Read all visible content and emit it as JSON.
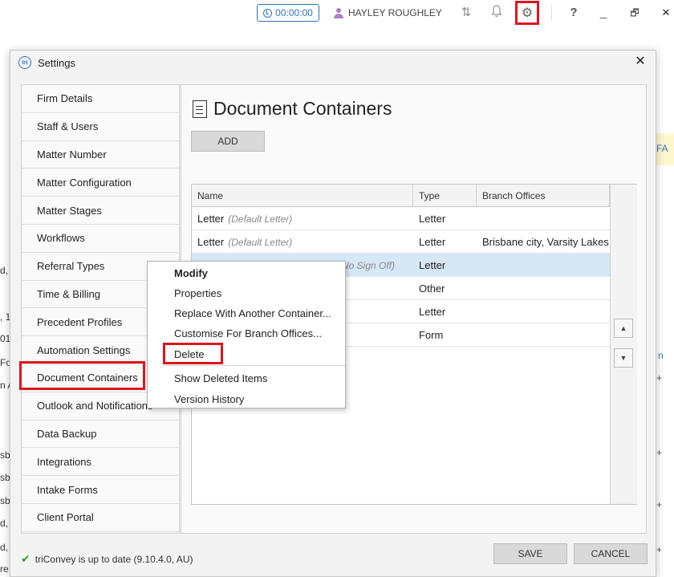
{
  "topbar": {
    "timer": "00:00:00",
    "user_name": "HAYLEY ROUGHLEY",
    "icons": {
      "sync": "sync-arrows-icon",
      "bell": "bell-icon",
      "gear": "gear-icon",
      "help": "?",
      "minimize": "_",
      "restore": "restore-icon",
      "close": "✕"
    }
  },
  "background": {
    "left_fragments": [
      "d,",
      ", 1",
      "01",
      "Fo",
      "n A",
      "sba",
      "sba",
      "sba",
      "d,",
      "d,",
      "re"
    ],
    "right_fragments": [
      "FA",
      "n",
      "+",
      "+",
      "+",
      "+"
    ]
  },
  "dialog": {
    "title": "Settings",
    "nav": [
      "Firm Details",
      "Staff & Users",
      "Matter Number",
      "Matter Configuration",
      "Matter Stages",
      "Workflows",
      "Referral Types",
      "Time & Billing",
      "Precedent Profiles",
      "Automation Settings",
      "Document Containers",
      "Outlook and Notifications",
      "Data Backup",
      "Integrations",
      "Intake Forms",
      "Client Portal"
    ],
    "page_title": "Document Containers",
    "add_label": "ADD",
    "columns": [
      "Name",
      "Type",
      "Branch Offices"
    ],
    "rows": [
      {
        "name": "Letter",
        "note": "(Default Letter)",
        "type": "Letter",
        "branch": ""
      },
      {
        "name": "Letter",
        "note": "(Default Letter)",
        "type": "Letter",
        "branch": "Brisbane city, Varsity Lakes"
      },
      {
        "name": "",
        "note": "No Sign Off)",
        "type": "Letter",
        "branch": ""
      },
      {
        "name": "",
        "note": "",
        "type": "Other",
        "branch": ""
      },
      {
        "name": "",
        "note": "",
        "type": "Letter",
        "branch": ""
      },
      {
        "name": "",
        "note": "",
        "type": "Form",
        "branch": ""
      }
    ],
    "status": "triConvey is up to date (9.10.4.0, AU)",
    "save_label": "SAVE",
    "cancel_label": "CANCEL"
  },
  "context_menu": {
    "items": [
      "Modify",
      "Properties",
      "Replace With Another Container...",
      "Customise For Branch Offices...",
      "Delete",
      "Show Deleted Items",
      "Version History"
    ]
  },
  "colors": {
    "accent": "#2f74c0",
    "highlight": "#e0141e",
    "selected_row": "#d6e7f6"
  }
}
